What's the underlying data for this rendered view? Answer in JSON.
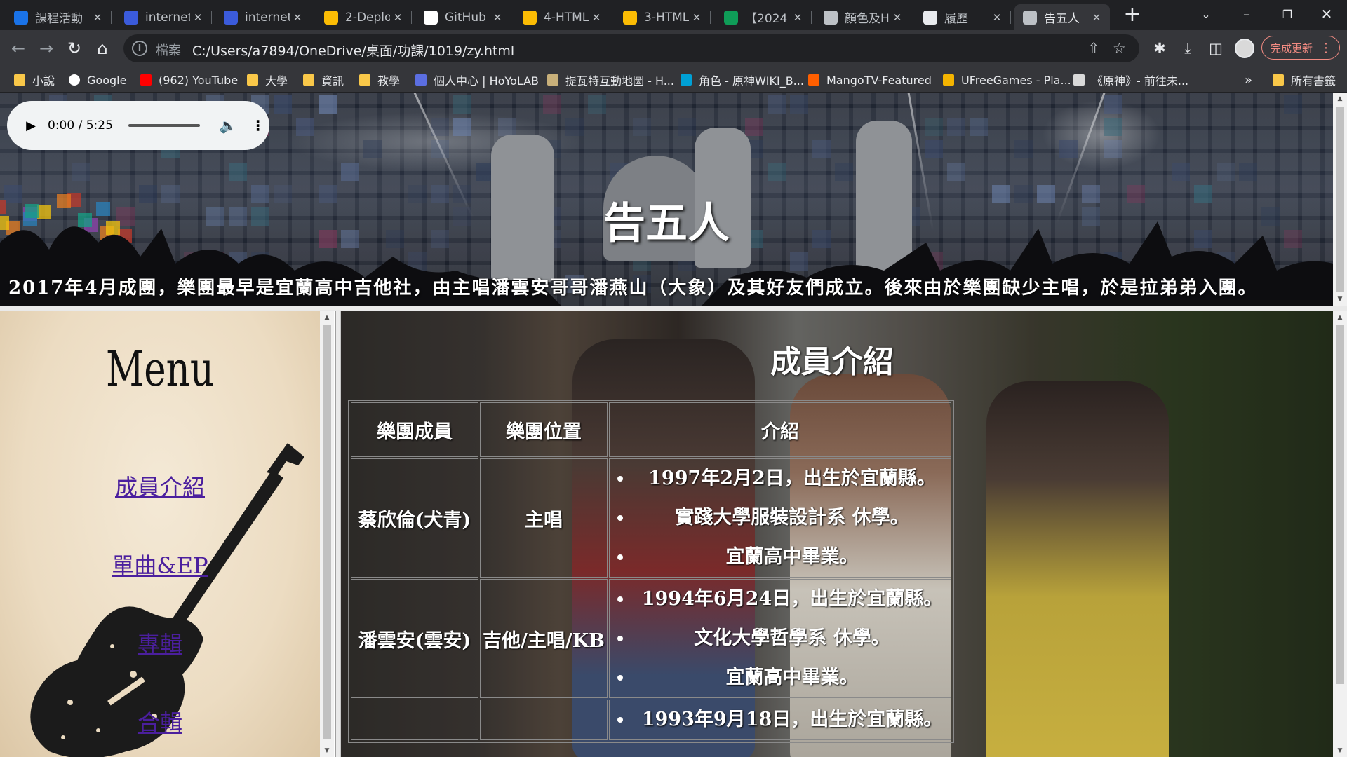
{
  "browser": {
    "tabs": [
      {
        "label": "課程活動",
        "favicon": "settings-icon",
        "color": "#1a73e8"
      },
      {
        "label": "internet",
        "favicon": "site-icon",
        "color": "#3b5bdb"
      },
      {
        "label": "internet",
        "favicon": "site-icon",
        "color": "#3b5bdb"
      },
      {
        "label": "2-Deplo",
        "favicon": "drive-icon",
        "color": "#fbbc04"
      },
      {
        "label": "GitHub",
        "favicon": "github-icon",
        "color": "#ffffff"
      },
      {
        "label": "4-HTML",
        "favicon": "drive-icon",
        "color": "#fbbc04"
      },
      {
        "label": "3-HTML",
        "favicon": "drive-icon",
        "color": "#fbbc04"
      },
      {
        "label": "【2024",
        "favicon": "c-icon",
        "color": "#0f9d58"
      },
      {
        "label": "顏色及H",
        "favicon": "globe-icon",
        "color": "#bdc1c6"
      },
      {
        "label": "履歷",
        "favicon": "resume-icon",
        "color": "#e8eaed"
      },
      {
        "label": "告五人",
        "favicon": "globe-icon",
        "color": "#bdc1c6",
        "active": true
      }
    ],
    "address": {
      "scheme": "檔案",
      "url": "C:/Users/a7894/OneDrive/桌面/功課/1019/zy.html"
    },
    "update_button": "完成更新",
    "bookmarks": [
      {
        "label": "小說",
        "icon": "folder-icon"
      },
      {
        "label": "Google",
        "icon": "google-icon"
      },
      {
        "label": "(962) YouTube",
        "icon": "youtube-icon"
      },
      {
        "label": "大學",
        "icon": "folder-icon"
      },
      {
        "label": "資訊",
        "icon": "folder-icon"
      },
      {
        "label": "教學",
        "icon": "folder-icon"
      },
      {
        "label": "個人中心 | HoYoLAB",
        "icon": "hoyolab-icon"
      },
      {
        "label": "提瓦特互動地圖 - H...",
        "icon": "map-icon"
      },
      {
        "label": "角色 - 原神WIKI_B...",
        "icon": "bilibili-icon"
      },
      {
        "label": "MangoTV-Featured",
        "icon": "mango-icon"
      },
      {
        "label": "UFreeGames - Pla...",
        "icon": "ufree-icon"
      },
      {
        "label": "《原神》- 前往未...",
        "icon": "genshin-icon"
      }
    ],
    "bookmarks_overflow": "»",
    "all_bookmarks": "所有書籤"
  },
  "banner": {
    "audio": {
      "time": "0:00 / 5:25"
    },
    "title": "告五人",
    "tagline": "2017年4月成團，樂團最早是宜蘭高中吉他社，由主唱潘雲安哥哥潘燕山（大象）及其好友們成立。後來由於樂團缺少主唱，於是拉弟弟入團。"
  },
  "menu": {
    "title": "Menu",
    "links": [
      "成員介紹",
      "單曲&EP",
      "專輯",
      "合輯"
    ]
  },
  "content": {
    "heading": "成員介紹",
    "table": {
      "headers": [
        "樂團成員",
        "樂團位置",
        "介紹"
      ],
      "rows": [
        {
          "member": "蔡欣倫(犬青)",
          "position": "主唱",
          "intro": [
            "1997年2月2日，出生於宜蘭縣。",
            "實踐大學服裝設計系 休學。",
            "宜蘭高中畢業。"
          ]
        },
        {
          "member": "潘雲安(雲安)",
          "position": "吉他/主唱/KB",
          "intro": [
            "1994年6月24日，出生於宜蘭縣。",
            "文化大學哲學系 休學。",
            "宜蘭高中畢業。"
          ]
        },
        {
          "member": "",
          "position": "",
          "intro": [
            "1993年9月18日，出生於宜蘭縣。"
          ]
        }
      ]
    }
  }
}
